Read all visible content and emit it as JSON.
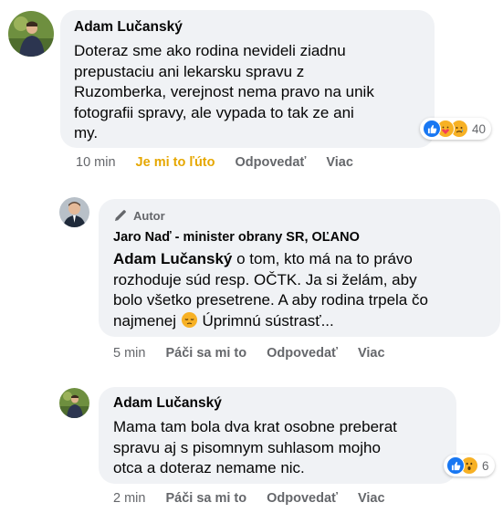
{
  "comment1": {
    "author": "Adam Lučanský",
    "lines": [
      "Doteraz sme ako rodina nevideli ziadnu",
      "prepustaciu ani lekarsku spravu z",
      "Ruzomberka, verejnost nema pravo na unik",
      "fotografii spravy, ale vypada to tak ze ani",
      "my."
    ],
    "reaction_count": "40",
    "reaction_icons": [
      "like-icon",
      "care-icon",
      "sad-icon"
    ],
    "time": "10 min",
    "reaction_label": "Je mi to ľúto",
    "reply_label": "Odpovedať",
    "more_label": "Viac",
    "reaction_color": "#e6a700"
  },
  "comment2": {
    "badge": "Autor",
    "author": "Jaro Naď - minister obrany SR, OĽANO",
    "mention": "Adam Lučanský",
    "first_line_rest": " o tom, kto má na to právo",
    "lines": [
      "rozhoduje súd resp. OČTK. Ja si želám, aby",
      "bolo všetko presetrene. A aby rodina trpela čo"
    ],
    "last_line_start": "najmenej ",
    "last_line_end": " Úprimnú sústrasť...",
    "emoji": "pensive-face-icon",
    "time": "5 min",
    "reaction_label": "Páči sa mi to",
    "reply_label": "Odpovedať",
    "more_label": "Viac"
  },
  "comment3": {
    "author": "Adam Lučanský",
    "lines": [
      "Mama tam bola dva krat osobne preberat",
      "spravu aj s pisomnym suhlasom mojho",
      "otca a doteraz nemame nic."
    ],
    "reaction_count": "6",
    "reaction_icons": [
      "like-icon",
      "wow-icon"
    ],
    "time": "2 min",
    "reaction_label": "Páči sa mi to",
    "reply_label": "Odpovedať",
    "more_label": "Viac"
  }
}
